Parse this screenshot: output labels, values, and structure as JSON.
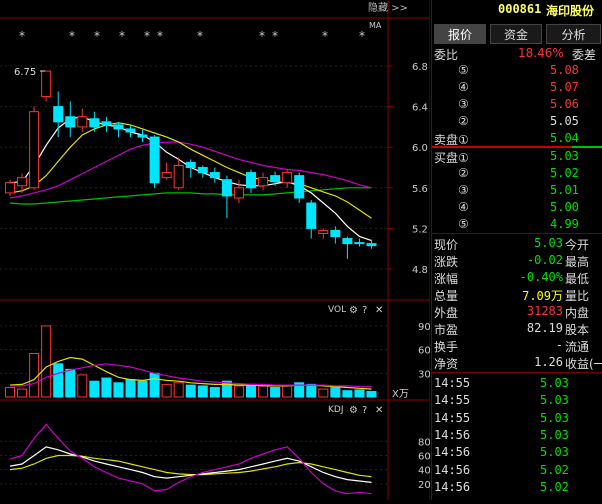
{
  "top_bar": {
    "hide_label": "隐藏 >>",
    "stock_code": "000861",
    "stock_name": "海印股份"
  },
  "tabs": [
    {
      "label": "报价",
      "active": true
    },
    {
      "label": "资金",
      "active": false
    },
    {
      "label": "分析",
      "active": false
    }
  ],
  "chart": {
    "ma_label": "MA",
    "high_marker": "6.75",
    "price_axis": [
      "6.8",
      "6.4",
      "6.0",
      "5.6",
      "5.2",
      "4.8"
    ],
    "vol_header": "VOL",
    "vol_axis": [
      "90",
      "60",
      "30"
    ],
    "vol_unit": "X万",
    "kdj_header": "KDJ",
    "kdj_axis": [
      "80",
      "60",
      "40",
      "20"
    ],
    "candles": [
      {
        "o": 5.55,
        "c": 5.65,
        "h": 5.68,
        "l": 5.52
      },
      {
        "o": 5.62,
        "c": 5.7,
        "h": 5.74,
        "l": 5.55
      },
      {
        "o": 5.6,
        "c": 6.35,
        "h": 6.4,
        "l": 5.58
      },
      {
        "o": 6.5,
        "c": 6.75,
        "h": 6.75,
        "l": 6.45
      },
      {
        "o": 6.4,
        "c": 6.25,
        "h": 6.55,
        "l": 6.1
      },
      {
        "o": 6.3,
        "c": 6.2,
        "h": 6.45,
        "l": 6.1
      },
      {
        "o": 6.2,
        "c": 6.3,
        "h": 6.38,
        "l": 6.15
      },
      {
        "o": 6.28,
        "c": 6.2,
        "h": 6.35,
        "l": 6.15
      },
      {
        "o": 6.25,
        "c": 6.22,
        "h": 6.3,
        "l": 6.15
      },
      {
        "o": 6.22,
        "c": 6.18,
        "h": 6.25,
        "l": 6.1
      },
      {
        "o": 6.18,
        "c": 6.15,
        "h": 6.22,
        "l": 6.1
      },
      {
        "o": 6.12,
        "c": 6.1,
        "h": 6.18,
        "l": 6.05
      },
      {
        "o": 6.1,
        "c": 5.65,
        "h": 6.12,
        "l": 5.6
      },
      {
        "o": 5.7,
        "c": 5.75,
        "h": 5.85,
        "l": 5.68
      },
      {
        "o": 5.6,
        "c": 5.82,
        "h": 5.9,
        "l": 5.58
      },
      {
        "o": 5.85,
        "c": 5.8,
        "h": 5.88,
        "l": 5.7
      },
      {
        "o": 5.8,
        "c": 5.75,
        "h": 5.82,
        "l": 5.7
      },
      {
        "o": 5.75,
        "c": 5.7,
        "h": 5.8,
        "l": 5.65
      },
      {
        "o": 5.68,
        "c": 5.52,
        "h": 5.72,
        "l": 5.3
      },
      {
        "o": 5.5,
        "c": 5.6,
        "h": 5.68,
        "l": 5.45
      },
      {
        "o": 5.75,
        "c": 5.6,
        "h": 5.78,
        "l": 5.55
      },
      {
        "o": 5.62,
        "c": 5.7,
        "h": 5.75,
        "l": 5.58
      },
      {
        "o": 5.72,
        "c": 5.66,
        "h": 5.76,
        "l": 5.62
      },
      {
        "o": 5.65,
        "c": 5.75,
        "h": 5.78,
        "l": 5.6
      },
      {
        "o": 5.72,
        "c": 5.5,
        "h": 5.75,
        "l": 5.45
      },
      {
        "o": 5.45,
        "c": 5.2,
        "h": 5.48,
        "l": 5.1
      },
      {
        "o": 5.15,
        "c": 5.18,
        "h": 5.2,
        "l": 5.1
      },
      {
        "o": 5.18,
        "c": 5.12,
        "h": 5.22,
        "l": 5.05
      },
      {
        "o": 5.1,
        "c": 5.05,
        "h": 5.12,
        "l": 4.9
      },
      {
        "o": 5.06,
        "c": 5.05,
        "h": 5.1,
        "l": 5.02
      },
      {
        "o": 5.05,
        "c": 5.03,
        "h": 5.09,
        "l": 5.0
      }
    ],
    "ma5": [
      5.65,
      5.66,
      5.82,
      6.02,
      6.19,
      6.28,
      6.3,
      6.25,
      6.22,
      6.2,
      6.15,
      6.12,
      6.05,
      5.95,
      5.88,
      5.8,
      5.75,
      5.7,
      5.66,
      5.63,
      5.62,
      5.62,
      5.64,
      5.66,
      5.62,
      5.55,
      5.45,
      5.35,
      5.22,
      5.12,
      5.08
    ],
    "ma10": [
      5.55,
      5.57,
      5.62,
      5.72,
      5.86,
      6.0,
      6.12,
      6.18,
      6.22,
      6.24,
      6.22,
      6.18,
      6.14,
      6.1,
      6.05,
      5.98,
      5.92,
      5.86,
      5.8,
      5.75,
      5.7,
      5.68,
      5.66,
      5.65,
      5.64,
      5.6,
      5.56,
      5.52,
      5.46,
      5.38,
      5.3
    ],
    "ma20": [
      5.5,
      5.52,
      5.55,
      5.58,
      5.62,
      5.68,
      5.74,
      5.8,
      5.86,
      5.92,
      5.98,
      6.02,
      6.04,
      6.05,
      6.05,
      6.03,
      6.0,
      5.96,
      5.92,
      5.88,
      5.85,
      5.82,
      5.8,
      5.78,
      5.77,
      5.75,
      5.73,
      5.7,
      5.67,
      5.63,
      5.6
    ],
    "ma60": [
      5.45,
      5.44,
      5.44,
      5.45,
      5.46,
      5.47,
      5.48,
      5.49,
      5.5,
      5.51,
      5.52,
      5.53,
      5.54,
      5.55,
      5.55,
      5.55,
      5.54,
      5.54,
      5.53,
      5.53,
      5.53,
      5.53,
      5.54,
      5.55,
      5.56,
      5.57,
      5.58,
      5.59,
      5.6,
      5.6,
      5.6
    ],
    "volumes": [
      12,
      10,
      55,
      90,
      42,
      35,
      28,
      20,
      24,
      18,
      22,
      20,
      30,
      16,
      18,
      15,
      14,
      12,
      20,
      14,
      16,
      14,
      12,
      15,
      18,
      16,
      10,
      12,
      8,
      9,
      7
    ],
    "vol_ma5": [
      15,
      16,
      22,
      38,
      45,
      50,
      48,
      40,
      32,
      25,
      22,
      21,
      23,
      21,
      20,
      18,
      17,
      16,
      16,
      15,
      15,
      14,
      14,
      14,
      15,
      15,
      14,
      13,
      12,
      11,
      10
    ],
    "vol_ma10": [
      14,
      14,
      17,
      25,
      30,
      34,
      37,
      40,
      42,
      40,
      38,
      34,
      30,
      27,
      24,
      22,
      20,
      19,
      18,
      17,
      16,
      16,
      15,
      15,
      15,
      15,
      15,
      14,
      14,
      13,
      13
    ],
    "kdj_k": [
      45,
      48,
      60,
      72,
      68,
      62,
      58,
      52,
      48,
      44,
      40,
      36,
      30,
      28,
      30,
      32,
      34,
      36,
      38,
      40,
      44,
      48,
      52,
      56,
      52,
      44,
      36,
      30,
      26,
      24,
      22
    ],
    "kdj_d": [
      40,
      42,
      48,
      56,
      60,
      60,
      59,
      56,
      54,
      52,
      48,
      44,
      40,
      36,
      34,
      33,
      33,
      34,
      35,
      36,
      38,
      41,
      44,
      48,
      50,
      48,
      44,
      40,
      36,
      32,
      30
    ],
    "kdj_j": [
      55,
      60,
      84,
      104,
      84,
      66,
      56,
      44,
      36,
      28,
      24,
      20,
      10,
      12,
      22,
      30,
      36,
      40,
      44,
      48,
      56,
      62,
      68,
      72,
      56,
      36,
      20,
      10,
      6,
      8,
      6
    ]
  },
  "panel": {
    "webi": {
      "label": "委比",
      "value": "18.46%",
      "right": "委差"
    },
    "sell": [
      {
        "label": "⑤",
        "price": "5.08"
      },
      {
        "label": "④",
        "price": "5.07"
      },
      {
        "label": "③",
        "price": "5.06"
      },
      {
        "label": "②",
        "price": "5.05"
      },
      {
        "label": "卖盘①",
        "price": "5.04"
      }
    ],
    "buy": [
      {
        "label": "买盘①",
        "price": "5.03"
      },
      {
        "label": "②",
        "price": "5.02"
      },
      {
        "label": "③",
        "price": "5.01"
      },
      {
        "label": "④",
        "price": "5.00"
      },
      {
        "label": "⑤",
        "price": "4.99"
      }
    ],
    "stats": [
      {
        "label": "现价",
        "value": "5.03",
        "right": "今开",
        "color": "#00e000"
      },
      {
        "label": "涨跌",
        "value": "-0.02",
        "right": "最高",
        "color": "#00e000"
      },
      {
        "label": "涨幅",
        "value": "-0.40%",
        "right": "最低",
        "color": "#00e000"
      },
      {
        "label": "总量",
        "value": "7.09万",
        "right": "量比",
        "color": "#ffff00"
      },
      {
        "label": "外盘",
        "value": "31283",
        "right": "内盘",
        "color": "#ff3333"
      },
      {
        "label": "市盈",
        "value": "82.19",
        "right": "股本",
        "color": "#dddddd"
      },
      {
        "label": "换手",
        "value": "-",
        "right": "流通",
        "color": "#dddddd"
      },
      {
        "label": "净资",
        "value": "1.26",
        "right": "收益(一",
        "color": "#dddddd"
      }
    ],
    "ticks": [
      {
        "time": "14:55",
        "price": "5.03"
      },
      {
        "time": "14:55",
        "price": "5.03"
      },
      {
        "time": "14:55",
        "price": "5.03"
      },
      {
        "time": "14:56",
        "price": "5.03"
      },
      {
        "time": "14:56",
        "price": "5.03"
      },
      {
        "time": "14:56",
        "price": "5.02"
      },
      {
        "time": "14:56",
        "price": "5.02"
      }
    ]
  }
}
